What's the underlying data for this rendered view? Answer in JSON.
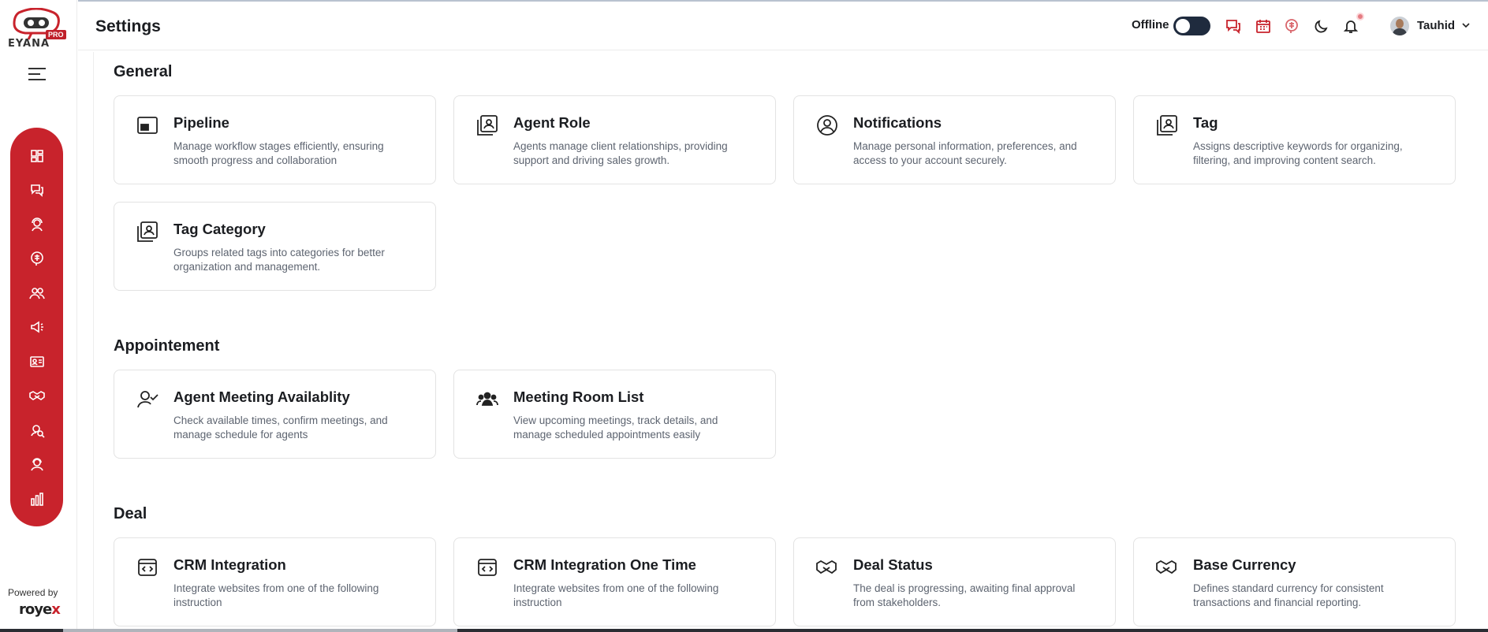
{
  "app": {
    "logo_text": "EYANA",
    "logo_badge": "PRO",
    "powered_by": "Powered by",
    "vendor_name_a": "roye",
    "vendor_name_b": "x"
  },
  "header": {
    "title": "Settings",
    "status_label": "Offline",
    "user_name": "Tauhid"
  },
  "sidebar": {
    "items": [
      {
        "icon": "dashboard-icon"
      },
      {
        "icon": "chat-icon"
      },
      {
        "icon": "support-agent-icon"
      },
      {
        "icon": "ai-brain-icon"
      },
      {
        "icon": "users-icon"
      },
      {
        "icon": "megaphone-icon"
      },
      {
        "icon": "contacts-card-icon"
      },
      {
        "icon": "handshake-icon"
      },
      {
        "icon": "search-user-icon"
      },
      {
        "icon": "agent-icon"
      },
      {
        "icon": "bar-chart-icon"
      }
    ]
  },
  "sections": {
    "general": {
      "title": "General",
      "cards": [
        {
          "title": "Pipeline",
          "desc": "Manage workflow stages efficiently, ensuring smooth progress and collaboration"
        },
        {
          "title": "Agent Role",
          "desc": "Agents manage client relationships, providing support and driving sales growth."
        },
        {
          "title": "Notifications",
          "desc": "Manage personal information, preferences, and access to your account securely."
        },
        {
          "title": "Tag",
          "desc": "Assigns descriptive keywords for organizing, filtering, and improving content search."
        },
        {
          "title": "Tag Category",
          "desc": "Groups related tags into categories for better organization and management."
        }
      ]
    },
    "appointment": {
      "title": "Appointement",
      "cards": [
        {
          "title": "Agent Meeting Availablity",
          "desc": "Check available times, confirm meetings, and manage schedule for agents"
        },
        {
          "title": "Meeting Room List",
          "desc": "View upcoming meetings, track details, and manage scheduled appointments easily"
        }
      ]
    },
    "deal": {
      "title": "Deal",
      "cards": [
        {
          "title": "CRM Integration",
          "desc": "Integrate websites from one of the following instruction"
        },
        {
          "title": "CRM Integration One Time",
          "desc": "Integrate websites from one of the following instruction"
        },
        {
          "title": "Deal Status",
          "desc": "The deal is progressing, awaiting final approval from stakeholders."
        },
        {
          "title": "Base Currency",
          "desc": "Defines standard currency for consistent transactions and financial reporting."
        }
      ]
    }
  },
  "colors": {
    "brand_red": "#c8232c",
    "toggle_dark": "#1f2b3e",
    "text_dark": "#1b1d21",
    "text_muted": "#5d6470"
  }
}
